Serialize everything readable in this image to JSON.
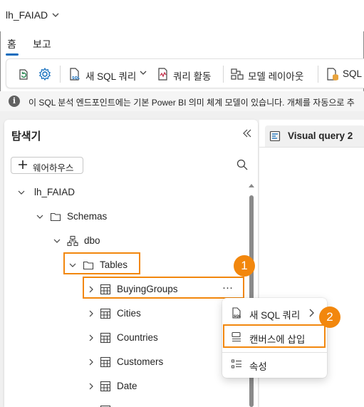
{
  "workspace": {
    "name": "lh_FAIAD"
  },
  "tabs": [
    {
      "label": "홈",
      "active": true
    },
    {
      "label": "보고"
    }
  ],
  "ribbon": {
    "new_sql_query": "새 SQL 쿼리",
    "query_activity": "쿼리 활동",
    "model_layout": "모델 레이아웃",
    "sql_truncated": "SQL"
  },
  "info_bar": {
    "text": "이 SQL 분석 엔드포인트에는 기본 Power BI 의미 체계 모델이 있습니다. 개체를 자동으로 추"
  },
  "explorer": {
    "title": "탐색기",
    "add_warehouse": "웨어하우스",
    "tree": {
      "root": "lh_FAIAD",
      "schemas": "Schemas",
      "schema": "dbo",
      "tables_folder": "Tables",
      "tables": [
        "BuyingGroups",
        "Cities",
        "Countries",
        "Customers",
        "Date"
      ],
      "more_options": "···"
    }
  },
  "editor": {
    "tab_label": "Visual query 2"
  },
  "context_menu": {
    "items": [
      {
        "label": "새 SQL 쿼리",
        "has_submenu": true
      },
      {
        "label": "캔버스에 삽입"
      },
      {
        "label": "속성"
      }
    ]
  },
  "callouts": {
    "one": "1",
    "two": "2"
  },
  "colors": {
    "accent": "#0f6cbd",
    "highlight": "#f2870d",
    "workarea": "#f0f0f0"
  }
}
